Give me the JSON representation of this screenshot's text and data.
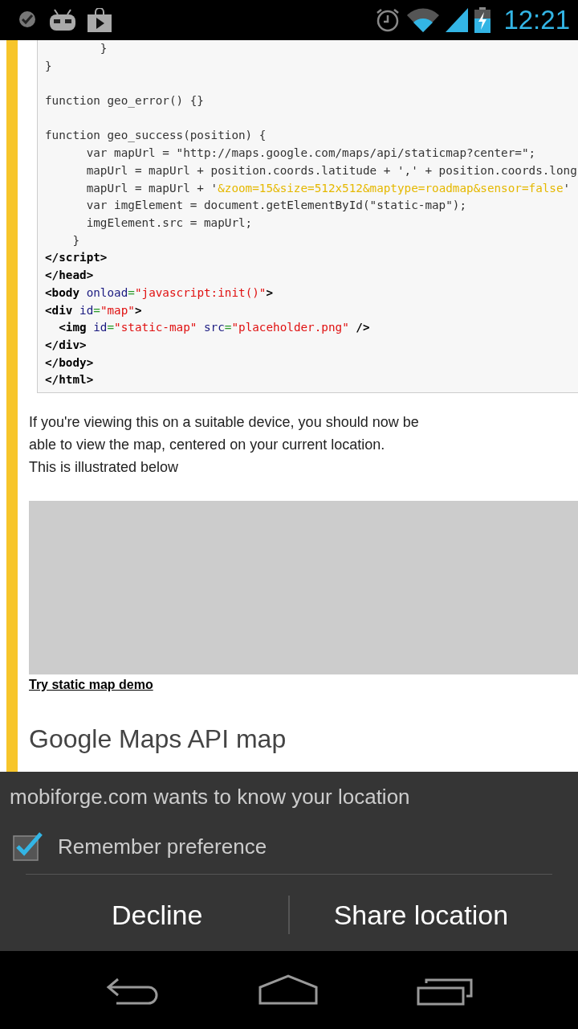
{
  "status_bar": {
    "time": "12:21"
  },
  "code_block": {
    "lines": [
      {
        "kind": "code",
        "tokens": [
          {
            "kind": "plain",
            "text": "        }"
          }
        ]
      },
      {
        "kind": "code",
        "tokens": [
          {
            "kind": "plain",
            "text": "}"
          }
        ]
      },
      {
        "kind": "blank"
      },
      {
        "kind": "code",
        "tokens": [
          {
            "kind": "plain",
            "text": "function geo_error() {}"
          }
        ]
      },
      {
        "kind": "blank"
      },
      {
        "kind": "code",
        "tokens": [
          {
            "kind": "plain",
            "text": "function geo_success(position) {"
          }
        ]
      },
      {
        "kind": "code",
        "tokens": [
          {
            "kind": "plain",
            "text": "      var mapUrl = \"http://maps.google.com/maps/api/staticmap?center=\";"
          }
        ]
      },
      {
        "kind": "code",
        "tokens": [
          {
            "kind": "plain",
            "text": "      mapUrl = mapUrl + position.coords.latitude + ',' + position.coords.long"
          }
        ]
      },
      {
        "kind": "code",
        "tokens": [
          {
            "kind": "plain",
            "text": "      mapUrl = mapUrl + '"
          },
          {
            "kind": "jsstr",
            "text": "&zoom=15&size=512x512&maptype=roadmap&sensor=false"
          },
          {
            "kind": "plain",
            "text": "'"
          }
        ]
      },
      {
        "kind": "code",
        "tokens": [
          {
            "kind": "plain",
            "text": "      var imgElement = document.getElementById(\"static-map\");"
          }
        ]
      },
      {
        "kind": "code",
        "tokens": [
          {
            "kind": "plain",
            "text": "      imgElement.src = mapUrl;"
          }
        ]
      },
      {
        "kind": "code",
        "tokens": [
          {
            "kind": "plain",
            "text": "    }"
          }
        ]
      },
      {
        "kind": "code",
        "tokens": [
          {
            "kind": "tag",
            "text": "</script>"
          }
        ]
      },
      {
        "kind": "code",
        "tokens": [
          {
            "kind": "tag",
            "text": "</head>"
          }
        ]
      },
      {
        "kind": "code",
        "tokens": [
          {
            "kind": "tag",
            "text": "<body "
          },
          {
            "kind": "attr",
            "text": "onload"
          },
          {
            "kind": "eq",
            "text": "="
          },
          {
            "kind": "str",
            "text": "\"javascript:init()\""
          },
          {
            "kind": "tag",
            "text": ">"
          }
        ]
      },
      {
        "kind": "code",
        "tokens": [
          {
            "kind": "tag",
            "text": "<div "
          },
          {
            "kind": "attr",
            "text": "id"
          },
          {
            "kind": "eq",
            "text": "="
          },
          {
            "kind": "str",
            "text": "\"map\""
          },
          {
            "kind": "tag",
            "text": ">"
          }
        ]
      },
      {
        "kind": "code",
        "tokens": [
          {
            "kind": "tag",
            "text": "  <img "
          },
          {
            "kind": "attr",
            "text": "id"
          },
          {
            "kind": "eq",
            "text": "="
          },
          {
            "kind": "str",
            "text": "\"static-map\""
          },
          {
            "kind": "attr",
            "text": " src"
          },
          {
            "kind": "eq",
            "text": "="
          },
          {
            "kind": "str",
            "text": "\"placeholder.png\""
          },
          {
            "kind": "tag",
            "text": " />"
          }
        ]
      },
      {
        "kind": "code",
        "tokens": [
          {
            "kind": "tag",
            "text": "</div>"
          }
        ]
      },
      {
        "kind": "code",
        "tokens": [
          {
            "kind": "tag",
            "text": "</body>"
          }
        ]
      },
      {
        "kind": "code",
        "tokens": [
          {
            "kind": "tag",
            "text": "</html>"
          }
        ]
      }
    ]
  },
  "paragraph": "If you're viewing this on a suitable device, you should now be able to view the map, centered on your current location.\nThis is illustrated below",
  "demo_link": "Try static map demo",
  "heading": "Google Maps API map",
  "dialog": {
    "title": "mobiforge.com wants to know your location",
    "remember": {
      "label": "Remember preference",
      "checked": true
    },
    "buttons": [
      "Decline",
      "Share location"
    ]
  }
}
